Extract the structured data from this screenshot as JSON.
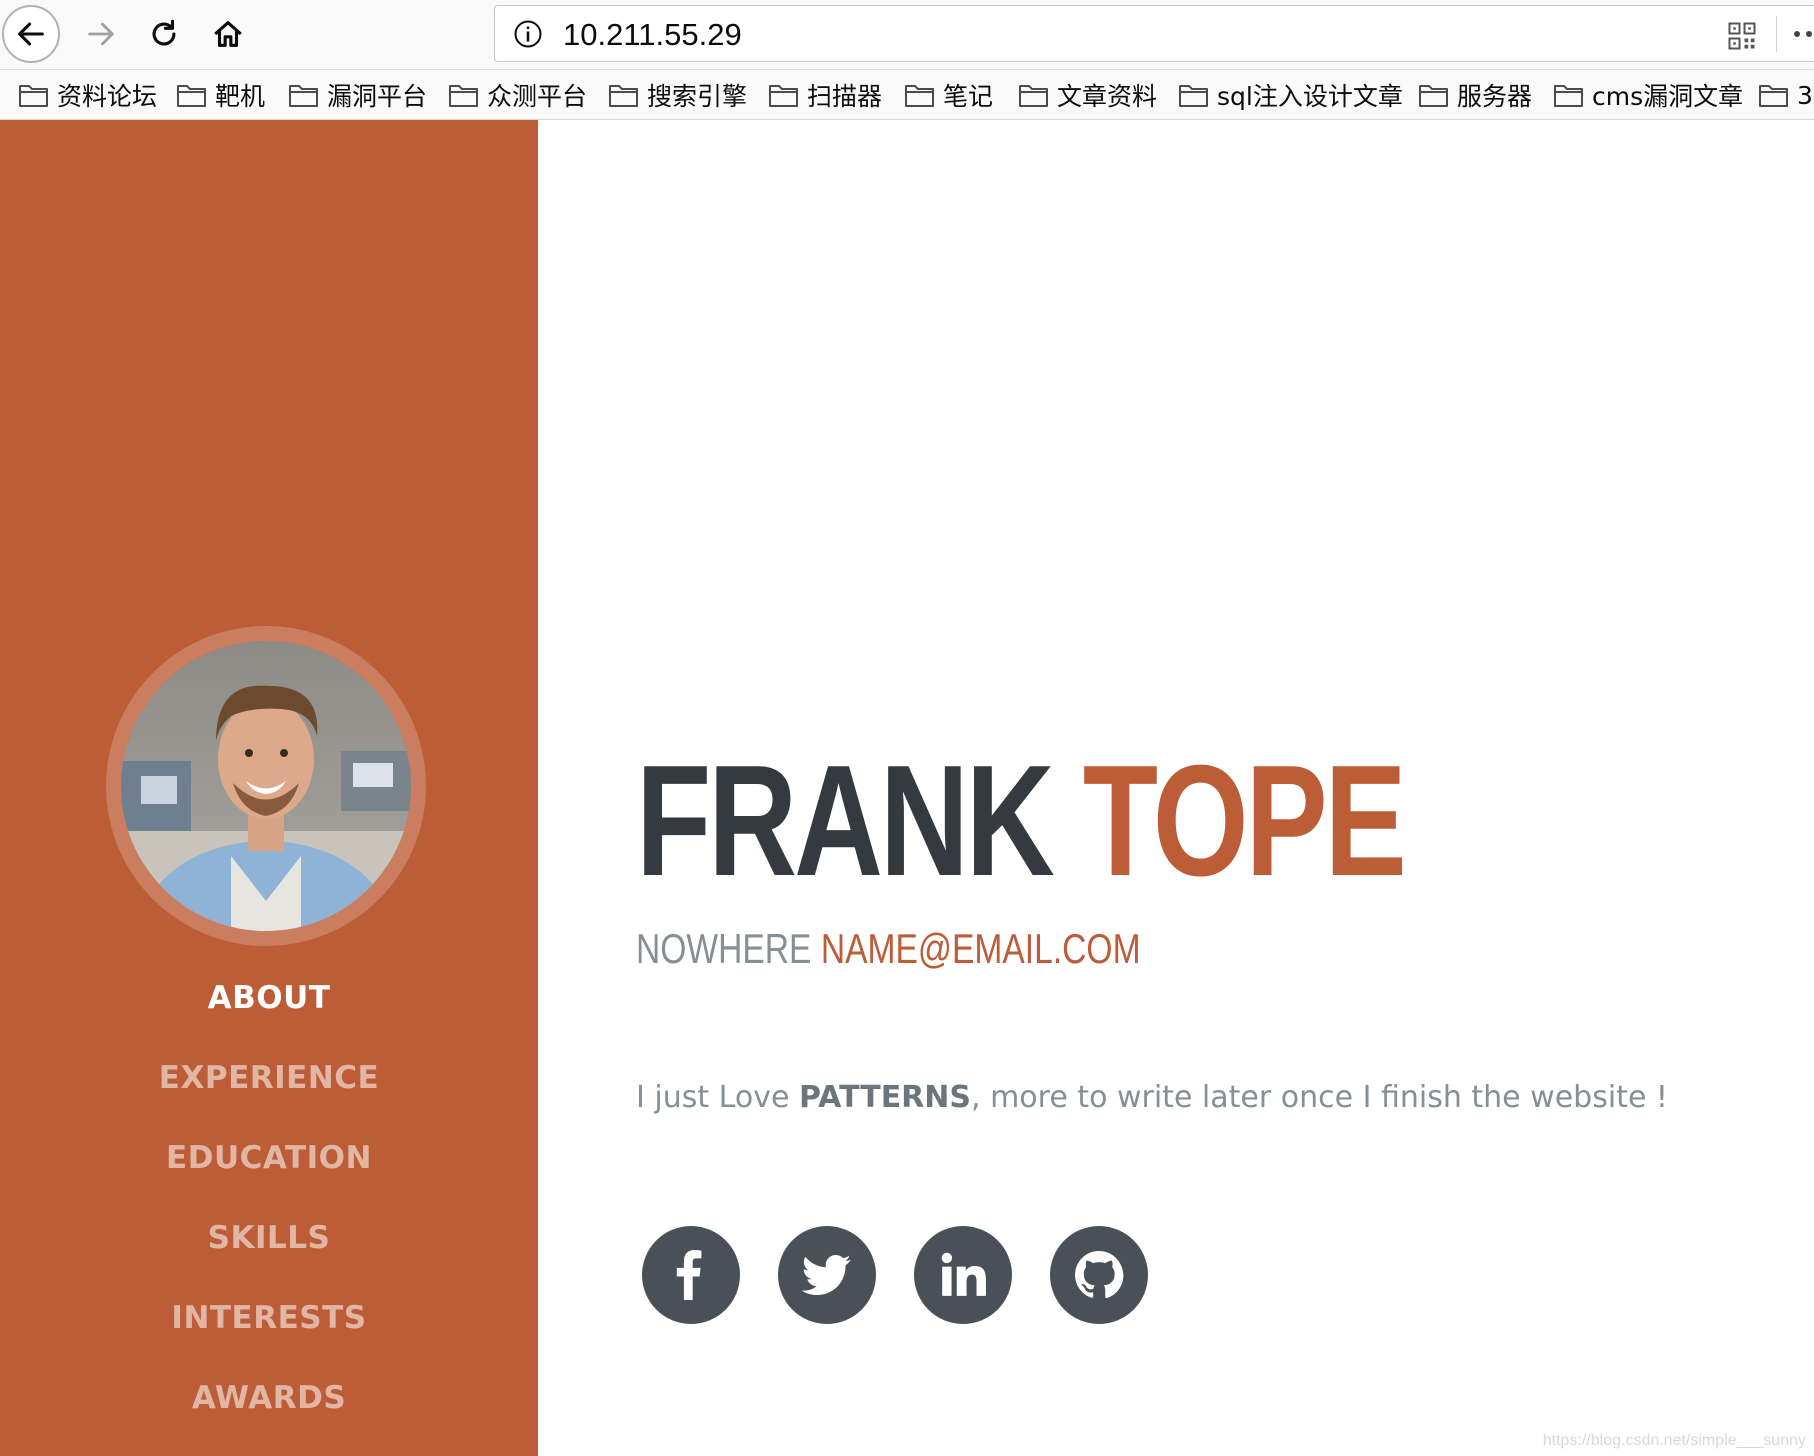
{
  "browser": {
    "url": "10.211.55.29",
    "bookmarks": [
      {
        "label": "资料论坛"
      },
      {
        "label": "靶机"
      },
      {
        "label": "漏洞平台"
      },
      {
        "label": "众测平台"
      },
      {
        "label": "搜索引擎"
      },
      {
        "label": "扫描器"
      },
      {
        "label": "笔记"
      },
      {
        "label": "文章资料"
      },
      {
        "label": "sql注入设计文章"
      },
      {
        "label": "服务器"
      },
      {
        "label": "cms漏洞文章"
      },
      {
        "label": "3"
      }
    ]
  },
  "sidebar": {
    "nav": [
      {
        "label": "About",
        "active": true
      },
      {
        "label": "Experience",
        "active": false
      },
      {
        "label": "Education",
        "active": false
      },
      {
        "label": "Skills",
        "active": false
      },
      {
        "label": "Interests",
        "active": false
      },
      {
        "label": "Awards",
        "active": false
      }
    ]
  },
  "about": {
    "first_name": "FRANK",
    "last_name": "TOPE",
    "location": "NOWHERE",
    "email": "NAME@EMAIL.COM",
    "lead_prefix": "I just Love ",
    "lead_bold": "PATTERNS",
    "lead_suffix": ", more to write later once I finish the website !",
    "social": [
      "facebook-icon",
      "twitter-icon",
      "linkedin-icon",
      "github-icon"
    ]
  },
  "watermark": "https://blog.csdn.net/simple___sunny",
  "colors": {
    "primary": "#bd5d38",
    "dark": "#343a40",
    "muted": "#868e96",
    "social_bg": "#495057"
  }
}
